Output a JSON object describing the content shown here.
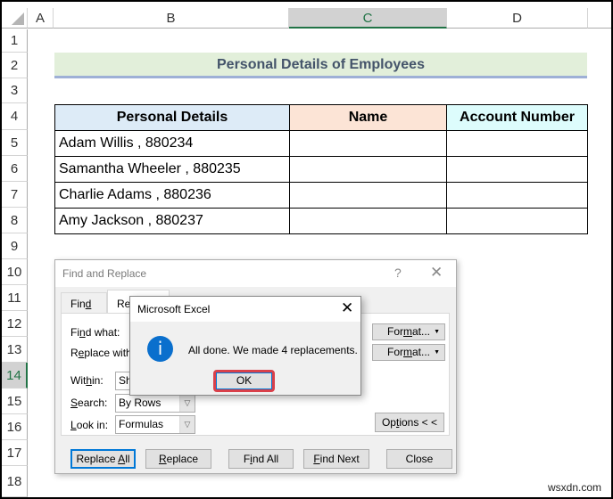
{
  "spreadsheet": {
    "columns": [
      {
        "label": "A",
        "active": false
      },
      {
        "label": "B",
        "active": false
      },
      {
        "label": "C",
        "active": true
      },
      {
        "label": "D",
        "active": false
      }
    ],
    "rows": [
      "1",
      "2",
      "3",
      "4",
      "5",
      "6",
      "7",
      "8",
      "9",
      "10",
      "11",
      "12",
      "13",
      "14",
      "15",
      "16",
      "17",
      "18"
    ],
    "active_row": "14",
    "title": "Personal Details of Employees",
    "table": {
      "headers": [
        "Personal Details",
        "Name",
        "Account Number"
      ],
      "rows": [
        [
          "Adam Willis , 880234",
          "",
          ""
        ],
        [
          "Samantha Wheeler , 880235",
          "",
          ""
        ],
        [
          "Charlie Adams , 880236",
          "",
          ""
        ],
        [
          "Amy Jackson , 880237",
          "",
          ""
        ]
      ]
    }
  },
  "find_replace": {
    "title": "Find and Replace",
    "help": "?",
    "close": "✕",
    "tabs": [
      {
        "pre": "Fin",
        "ul": "d",
        "post": "",
        "selected": false
      },
      {
        "pre": "Re",
        "ul": "",
        "post": "",
        "selected": true
      }
    ],
    "find_what": {
      "pre": "Fi",
      "ul": "n",
      "post": "d what:"
    },
    "replace_with": {
      "pre": "R",
      "ul": "e",
      "post": "place with"
    },
    "format_pre": "For",
    "format_ul": "m",
    "format_post": "at...",
    "within": {
      "pre": "Wit",
      "ul": "h",
      "post": "in:",
      "value": "Sh"
    },
    "search": {
      "pre": "",
      "ul": "S",
      "post": "earch:",
      "value": "By Rows"
    },
    "look_in": {
      "pre": "",
      "ul": "L",
      "post": "ook in:",
      "value": "Formulas"
    },
    "options": {
      "pre": "Op",
      "ul": "t",
      "post": "ions < <"
    },
    "buttons": {
      "replace_all": {
        "pre": "Replace ",
        "ul": "A",
        "post": "ll"
      },
      "replace": {
        "pre": "",
        "ul": "R",
        "post": "eplace"
      },
      "find_all": {
        "pre": "F",
        "ul": "i",
        "post": "nd All"
      },
      "find_next": {
        "pre": "",
        "ul": "F",
        "post": "ind Next"
      },
      "close": {
        "pre": "Close",
        "ul": "",
        "post": ""
      }
    }
  },
  "message_box": {
    "title": "Microsoft Excel",
    "close": "✕",
    "icon": "info-icon",
    "icon_glyph": "i",
    "message": "All done. We made 4 replacements.",
    "ok_label": "OK",
    "highlight_color": "#d9404a"
  },
  "watermark": "wsxdn.com"
}
